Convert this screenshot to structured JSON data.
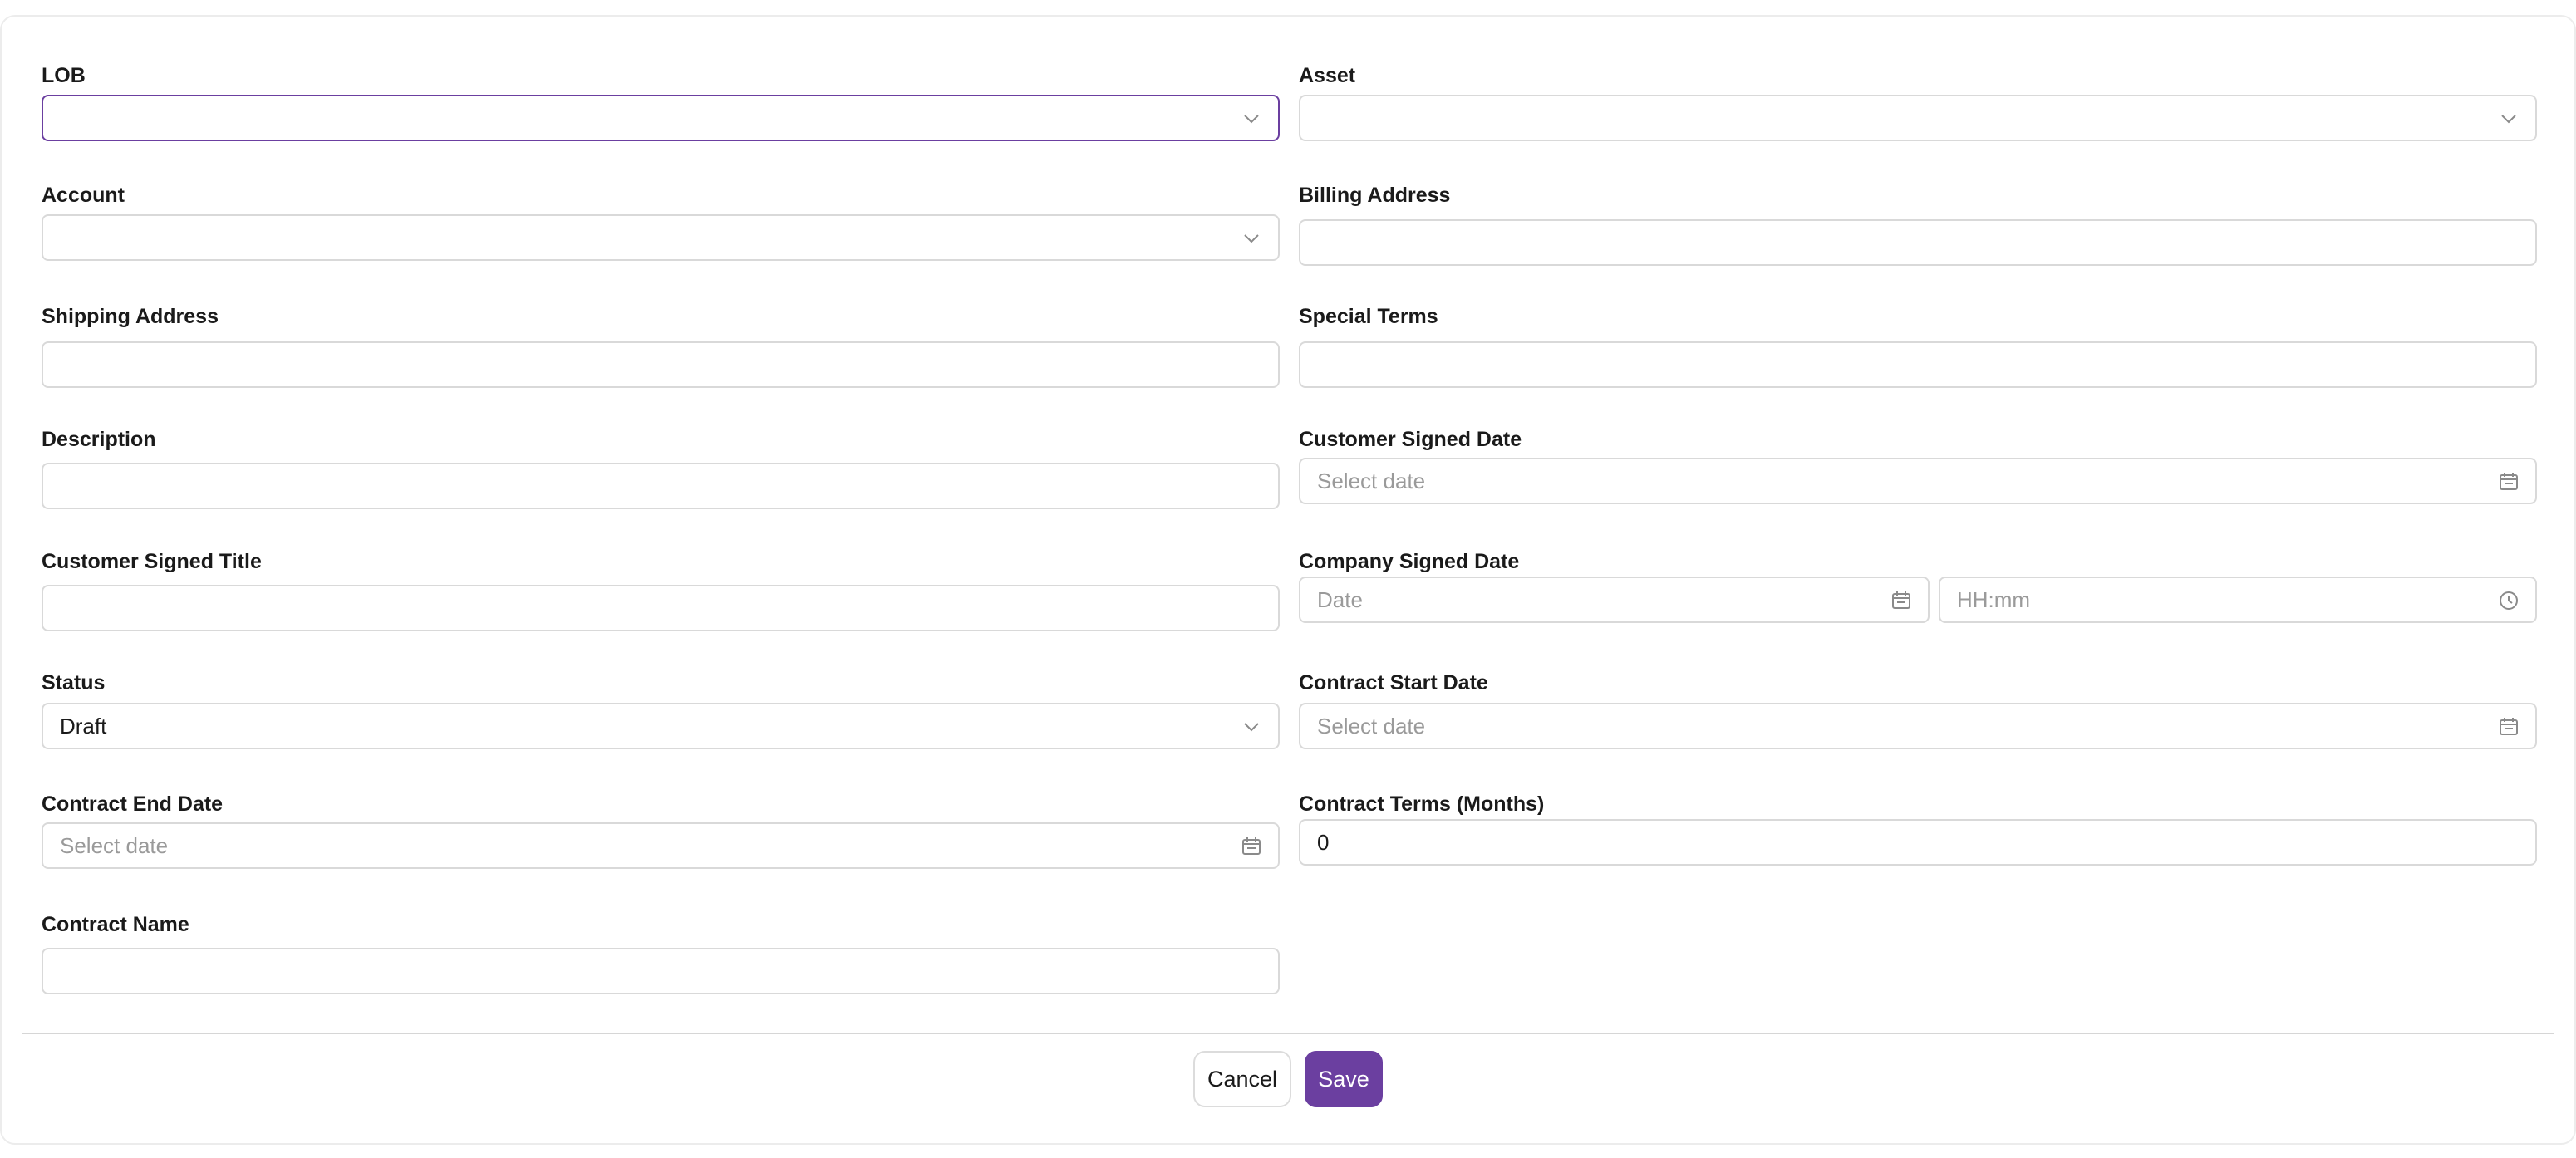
{
  "form": {
    "lob": {
      "label": "LOB",
      "value": ""
    },
    "asset": {
      "label": "Asset",
      "value": ""
    },
    "account": {
      "label": "Account",
      "value": ""
    },
    "billing_address": {
      "label": "Billing Address",
      "value": ""
    },
    "shipping_address": {
      "label": "Shipping Address",
      "value": ""
    },
    "special_terms": {
      "label": "Special Terms",
      "value": ""
    },
    "description": {
      "label": "Description",
      "value": ""
    },
    "customer_signed_date": {
      "label": "Customer Signed Date",
      "placeholder": "Select date"
    },
    "customer_signed_title": {
      "label": "Customer Signed Title",
      "value": ""
    },
    "company_signed_date": {
      "label": "Company Signed Date",
      "date_placeholder": "Date",
      "time_placeholder": "HH:mm"
    },
    "status": {
      "label": "Status",
      "value": "Draft"
    },
    "contract_start_date": {
      "label": "Contract Start Date",
      "placeholder": "Select date"
    },
    "contract_end_date": {
      "label": "Contract End Date",
      "placeholder": "Select date"
    },
    "contract_terms": {
      "label": "Contract Terms (Months)",
      "value": "0"
    },
    "contract_name": {
      "label": "Contract Name",
      "value": ""
    }
  },
  "actions": {
    "cancel_label": "Cancel",
    "save_label": "Save"
  },
  "colors": {
    "accent": "#6b3fa0",
    "border": "#d9d9d9",
    "placeholder": "#9a9a9a"
  },
  "icons": {
    "select": "chevron-down-icon",
    "date": "calendar-icon",
    "time": "clock-icon"
  }
}
